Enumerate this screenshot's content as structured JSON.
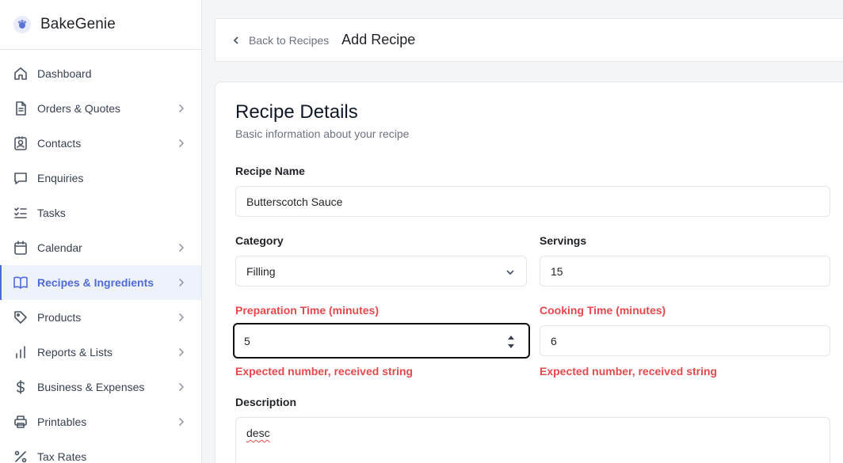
{
  "app": {
    "name": "BakeGenie"
  },
  "sidebar": {
    "items": [
      {
        "label": "Dashboard",
        "icon": "home-icon",
        "chevron": false,
        "active": false
      },
      {
        "label": "Orders & Quotes",
        "icon": "document-icon",
        "chevron": true,
        "active": false
      },
      {
        "label": "Contacts",
        "icon": "contact-card-icon",
        "chevron": true,
        "active": false
      },
      {
        "label": "Enquiries",
        "icon": "chat-bubble-icon",
        "chevron": false,
        "active": false
      },
      {
        "label": "Tasks",
        "icon": "checklist-icon",
        "chevron": false,
        "active": false
      },
      {
        "label": "Calendar",
        "icon": "calendar-icon",
        "chevron": true,
        "active": false
      },
      {
        "label": "Recipes & Ingredients",
        "icon": "book-icon",
        "chevron": true,
        "active": true
      },
      {
        "label": "Products",
        "icon": "tag-icon",
        "chevron": true,
        "active": false
      },
      {
        "label": "Reports & Lists",
        "icon": "bar-chart-icon",
        "chevron": true,
        "active": false
      },
      {
        "label": "Business & Expenses",
        "icon": "dollar-icon",
        "chevron": true,
        "active": false
      },
      {
        "label": "Printables",
        "icon": "printer-icon",
        "chevron": true,
        "active": false
      },
      {
        "label": "Tax Rates",
        "icon": "percent-icon",
        "chevron": false,
        "active": false
      }
    ]
  },
  "header": {
    "back_label": "Back to Recipes",
    "title": "Add Recipe"
  },
  "card": {
    "title": "Recipe Details",
    "subtitle": "Basic information about your recipe"
  },
  "form": {
    "recipe_name": {
      "label": "Recipe Name",
      "value": "Butterscotch Sauce"
    },
    "category": {
      "label": "Category",
      "value": "Filling"
    },
    "servings": {
      "label": "Servings",
      "value": "15"
    },
    "prep_time": {
      "label": "Preparation Time (minutes)",
      "value": "5",
      "error": "Expected number, received string"
    },
    "cook_time": {
      "label": "Cooking Time (minutes)",
      "value": "6",
      "error": "Expected number, received string"
    },
    "description": {
      "label": "Description",
      "value": "desc"
    }
  },
  "colors": {
    "accent": "#4f6bd8",
    "error": "#e5484d",
    "active_bg": "#eef2fb"
  }
}
